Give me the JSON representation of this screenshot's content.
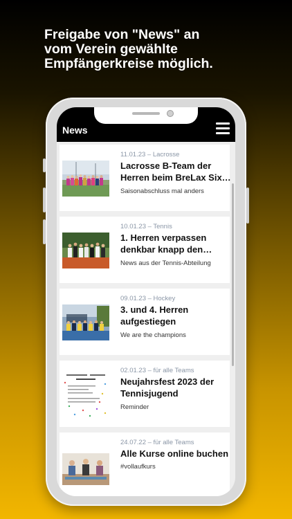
{
  "headline": {
    "line1": "Freigabe von \"News\" an",
    "line2": "vom Verein gewählte",
    "line3": "Empfängerkreise möglich."
  },
  "app": {
    "title": "News"
  },
  "news": [
    {
      "meta": "11.01.23 – Lacrosse",
      "title_lines": [
        "Lacrosse B-Team der",
        "Herren beim BreLax Six…"
      ],
      "subtitle": "Saisonabschluss mal anders"
    },
    {
      "meta": "10.01.23 – Tennis",
      "title_lines": [
        "1. Herren verpassen",
        "denkbar knapp den…"
      ],
      "subtitle": "News aus der Tennis-Abteilung"
    },
    {
      "meta": "09.01.23 – Hockey",
      "title_lines": [
        "3. und 4. Herren",
        "aufgestiegen"
      ],
      "subtitle": "We are the champions"
    },
    {
      "meta": "02.01.23 – für alle Teams",
      "title_lines": [
        "Neujahrsfest 2023 der",
        "Tennisjugend"
      ],
      "subtitle": "Reminder"
    },
    {
      "meta": "24.07.22 – für alle Teams",
      "title_lines": [
        "Alle Kurse online buchen"
      ],
      "subtitle": "#vollaufkurs"
    }
  ]
}
